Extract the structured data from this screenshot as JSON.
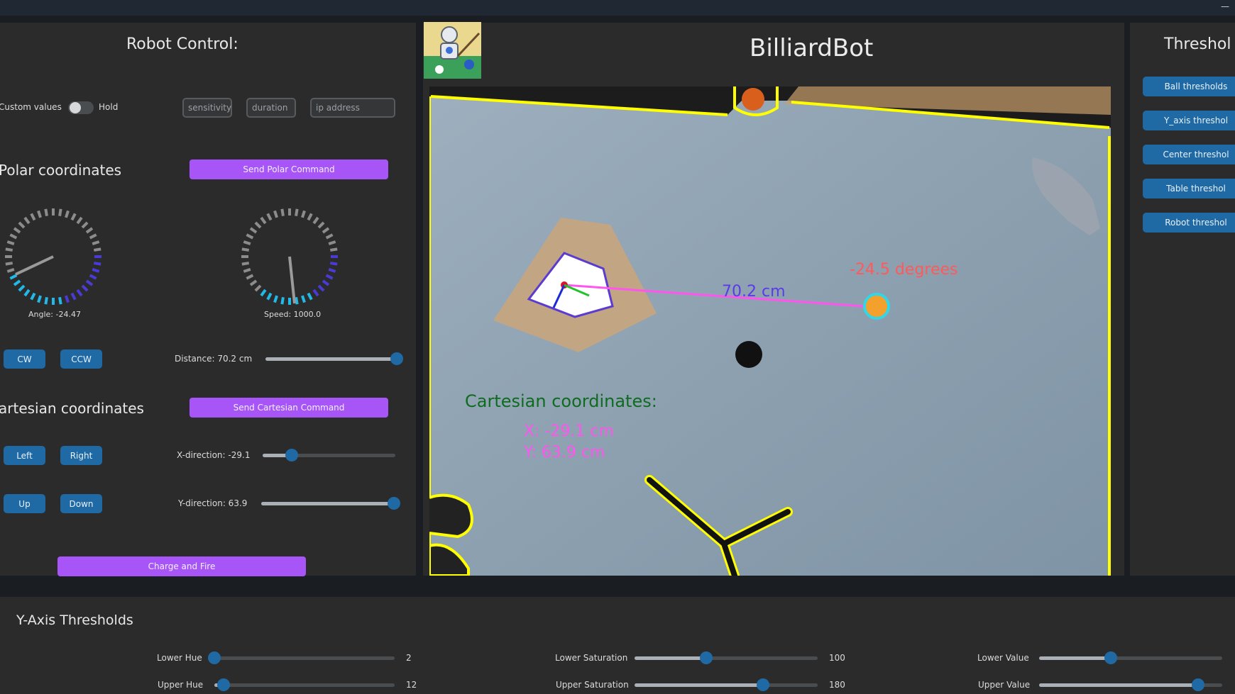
{
  "window": {
    "minimize_label": "—"
  },
  "left": {
    "title": "Robot Control:",
    "custom_values_label": "Custom values",
    "hold_label": "Hold",
    "sensitivity_placeholder": "sensitivity",
    "duration_placeholder": "duration",
    "ip_placeholder": "ip address",
    "polar_title": "Polar coordinates",
    "send_polar": "Send Polar Command",
    "angle_label": "Angle: -24.47",
    "speed_label": "Speed: 1000.0",
    "cw": "CW",
    "ccw": "CCW",
    "distance_label": "Distance: 70.2 cm",
    "distance_value": 1.0,
    "cartesian_title": "artesian coordinates",
    "send_cartesian": "Send Cartesian Command",
    "left_btn": "Left",
    "right_btn": "Right",
    "x_label": "X-direction: -29.1",
    "x_value": 0.22,
    "up_btn": "Up",
    "down_btn": "Down",
    "y_label": "Y-direction: 63.9",
    "y_value": 0.97,
    "charge_fire": "Charge and Fire"
  },
  "center": {
    "title": "BilliardBot",
    "overlay_distance": "70.2 cm",
    "overlay_degrees": "-24.5 degrees",
    "overlay_cart_title": "Cartesian coordinates:",
    "overlay_x": "X: -29.1 cm",
    "overlay_y": "Y: 63.9 cm"
  },
  "right": {
    "title": "Threshol",
    "buttons": [
      "Ball thresholds",
      "Y_axis threshol",
      "Center threshol",
      "Table threshol",
      "Robot threshol"
    ]
  },
  "bottom": {
    "title": "Y-Axis Thresholds",
    "lower_hue": "Lower Hue",
    "lower_hue_val": "2",
    "lower_hue_pos": 0.0,
    "upper_hue": "Upper Hue",
    "upper_hue_val": "12",
    "upper_hue_pos": 0.05,
    "lower_sat": "Lower Saturation",
    "lower_sat_val": "100",
    "lower_sat_pos": 0.39,
    "upper_sat": "Upper Saturation",
    "upper_sat_val": "180",
    "upper_sat_pos": 0.7,
    "lower_val": "Lower Value",
    "lower_val_pos": 0.39,
    "upper_val": "Upper Value",
    "upper_val_pos": 0.87
  },
  "colors": {
    "accent_purple": "#a855f7",
    "accent_blue": "#1f6aa5",
    "overlay_yellow": "#ffff00",
    "overlay_pink": "#ff55ee",
    "overlay_green": "#0f6b1f"
  }
}
